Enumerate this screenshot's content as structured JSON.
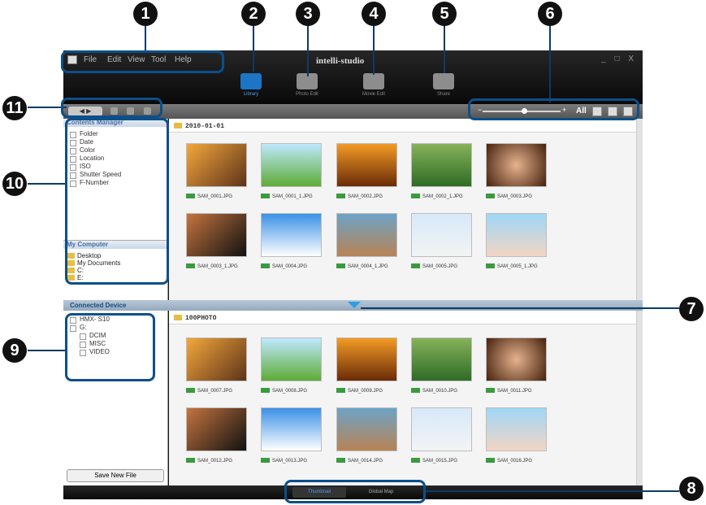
{
  "callouts": [
    "1",
    "2",
    "3",
    "4",
    "5",
    "6",
    "7",
    "8",
    "9",
    "10",
    "11"
  ],
  "app": {
    "title": "intelli-studio",
    "menu": [
      "File",
      "Edit",
      "View",
      "Tool",
      "Help"
    ],
    "window_controls": "_ □ X",
    "modes": [
      {
        "label": "Library",
        "icon": "library-icon",
        "active": true
      },
      {
        "label": "Photo Edit",
        "icon": "photo-edit-icon"
      },
      {
        "label": "Movie Edit",
        "icon": "movie-edit-icon"
      },
      {
        "label": "Share",
        "icon": "share-globe-icon"
      }
    ]
  },
  "toolbar": {
    "nav_label": "◀ ▶",
    "view_all": "All",
    "zoom_level": 0.5,
    "zoom_minus": "−",
    "zoom_plus": "+"
  },
  "contents_manager": {
    "title": "Contents Manager",
    "items": [
      "Folder",
      "Date",
      "Color",
      "Location",
      "ISO",
      "Shutter Speed",
      "F-Number"
    ]
  },
  "my_computer": {
    "title": "My Computer",
    "items": [
      "Desktop",
      "My Documents",
      "C:",
      "E:"
    ]
  },
  "library": {
    "folder": "2010-01-01",
    "files": [
      "SAM_0001.JPG",
      "SAM_0001_1.JPG",
      "SAM_0002.JPG",
      "SAM_0002_1.JPG",
      "SAM_0003.JPG",
      "SAM_0003_1.JPG",
      "SAM_0004.JPG",
      "SAM_0004_1.JPG",
      "SAM_0005.JPG",
      "SAM_0005_1.JPG"
    ]
  },
  "connected_device": {
    "title": "Connected Device",
    "items": [
      "HMX- S10",
      "G:",
      "DCIM",
      "MISC",
      "VIDEO"
    ],
    "save_button": "Save New File"
  },
  "device_library": {
    "folder": "100PHOTO",
    "files": [
      "SAM_0007.JPG",
      "SAM_0008.JPG",
      "SAM_0009.JPG",
      "SAM_0010.JPG",
      "SAM_0011.JPG",
      "SAM_0012.JPG",
      "SAM_0013.JPG",
      "SAM_0014.JPG",
      "SAM_0015.JPG",
      "SAM_0016.JPG"
    ]
  },
  "bottom_tabs": [
    "Thumbnail",
    "Global Map"
  ]
}
